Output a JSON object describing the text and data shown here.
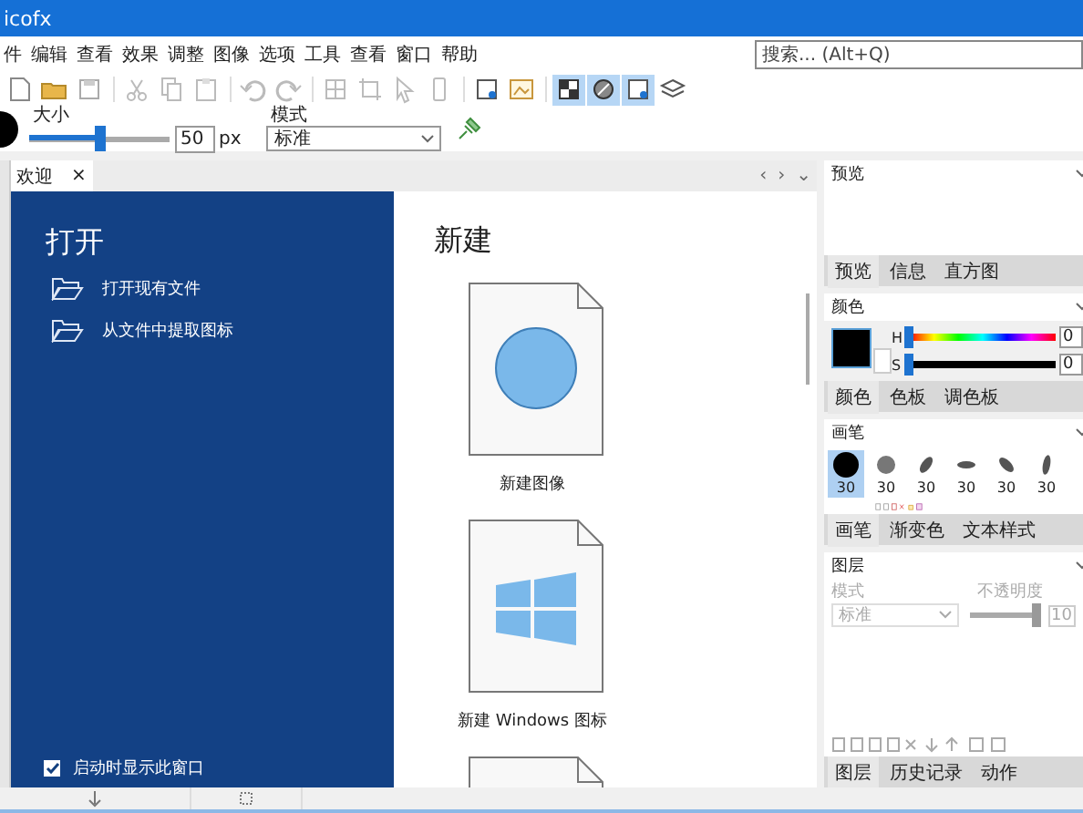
{
  "window": {
    "title": "icofx"
  },
  "menu": [
    "件",
    "编辑",
    "查看",
    "效果",
    "调整",
    "图像",
    "选项",
    "工具",
    "查看",
    "窗口",
    "帮助"
  ],
  "search": {
    "placeholder": "搜索... (Alt+Q)"
  },
  "toolbar": [
    {
      "kind": "new",
      "on": false
    },
    {
      "kind": "open",
      "on": false
    },
    {
      "kind": "save",
      "on": false
    },
    {
      "kind": "sep"
    },
    {
      "kind": "cut",
      "on": false
    },
    {
      "kind": "copy",
      "on": false
    },
    {
      "kind": "paste",
      "on": false
    },
    {
      "kind": "sep"
    },
    {
      "kind": "undo",
      "on": false
    },
    {
      "kind": "redo",
      "on": false
    },
    {
      "kind": "sep"
    },
    {
      "kind": "grid",
      "on": false
    },
    {
      "kind": "crop",
      "on": false
    },
    {
      "kind": "pointer",
      "on": false
    },
    {
      "kind": "phone",
      "on": false
    },
    {
      "kind": "sep"
    },
    {
      "kind": "frame",
      "on": false
    },
    {
      "kind": "image",
      "on": false
    },
    {
      "kind": "sep"
    },
    {
      "kind": "checker",
      "on": true
    },
    {
      "kind": "brush",
      "on": true
    },
    {
      "kind": "frame",
      "on": true
    },
    {
      "kind": "layers",
      "on": false
    }
  ],
  "options": {
    "size_label": "大小",
    "size_slider": {
      "level": 0.5
    },
    "size_value": "50",
    "unit": "px",
    "mode_label": "模式",
    "mode": "标准"
  },
  "doc_tabs": [
    {
      "label": "欢迎",
      "close": "×",
      "selected": true
    }
  ],
  "doc_nav": [
    "‹",
    "›",
    "⌄"
  ],
  "welcome": {
    "open_title": "打开",
    "open_items": [
      "打开现有文件",
      "从文件中提取图标"
    ],
    "show_on_start": {
      "label": "启动时显示此窗口",
      "checked": true
    },
    "new_title": "新建",
    "templates": [
      {
        "kind": "image",
        "label": "新建图像"
      },
      {
        "kind": "windows",
        "label": "新建 Windows 图标"
      },
      {
        "kind": "blank"
      }
    ]
  },
  "panels": [
    {
      "kind": "preview",
      "title": "预览",
      "tabs": [
        {
          "label": "预览",
          "selected": true
        },
        {
          "label": "信息",
          "selected": false
        },
        {
          "label": "直方图",
          "selected": false
        }
      ]
    },
    {
      "kind": "color",
      "title": "颜色",
      "color": "#000000",
      "sliders": [
        {
          "label": "H",
          "level": 0,
          "value": "0"
        },
        {
          "label": "S",
          "level": 0,
          "value": "0"
        }
      ],
      "tabs": [
        {
          "label": "颜色",
          "selected": true
        },
        {
          "label": "色板",
          "selected": false
        },
        {
          "label": "调色板",
          "selected": false
        }
      ]
    },
    {
      "kind": "brush",
      "title": "画笔",
      "brushes": [
        {
          "kind": "round",
          "size": "30",
          "selected": true
        },
        {
          "kind": "soft",
          "size": "30",
          "selected": false
        },
        {
          "kind": "slant",
          "size": "30",
          "selected": false
        },
        {
          "kind": "flat",
          "size": "30",
          "selected": false
        },
        {
          "kind": "back",
          "size": "30",
          "selected": false
        },
        {
          "kind": "tall",
          "size": "30",
          "selected": false
        }
      ],
      "tabs": [
        {
          "label": "画笔",
          "selected": true
        },
        {
          "label": "渐变色",
          "selected": false
        },
        {
          "label": "文本样式",
          "selected": false
        }
      ]
    },
    {
      "kind": "layers",
      "title": "图层",
      "mode_label": "模式",
      "opacity_label": "不透明度",
      "mode": "标准",
      "opacity_slider": {
        "level": 1
      },
      "opacity_value": "10",
      "disabled": true,
      "tabs": [
        {
          "label": "图层",
          "selected": true
        },
        {
          "label": "历史记录",
          "selected": false
        },
        {
          "label": "动作",
          "selected": false
        }
      ]
    }
  ]
}
